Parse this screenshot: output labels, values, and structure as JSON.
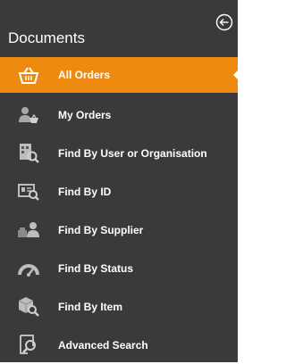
{
  "panel": {
    "title": "Documents",
    "back_icon": "circle-arrow-left-icon",
    "accent_color": "#ef8a11",
    "background_color": "#3a3a3a"
  },
  "menu": {
    "items": [
      {
        "label": "All Orders",
        "icon": "basket-icon",
        "active": true
      },
      {
        "label": "My Orders",
        "icon": "user-basket-icon",
        "active": false
      },
      {
        "label": "Find By User or Organisation",
        "icon": "user-search-icon",
        "active": false
      },
      {
        "label": "Find By ID",
        "icon": "id-card-search-icon",
        "active": false
      },
      {
        "label": "Find By Supplier",
        "icon": "supplier-icon",
        "active": false
      },
      {
        "label": "Find By Status",
        "icon": "gauge-icon",
        "active": false
      },
      {
        "label": "Find By Item",
        "icon": "box-search-icon",
        "active": false
      },
      {
        "label": "Advanced Search",
        "icon": "document-search-icon",
        "active": false
      }
    ]
  }
}
